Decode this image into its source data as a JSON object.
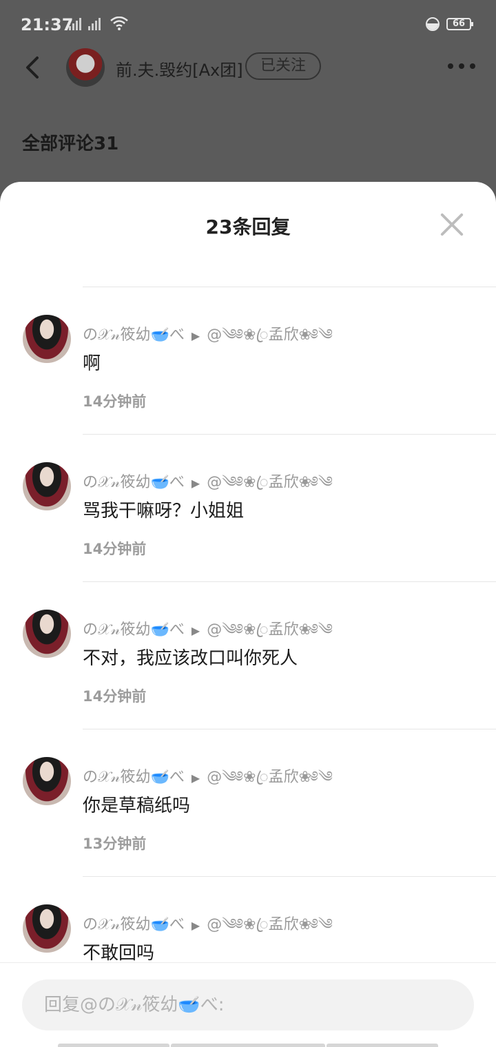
{
  "status_bar": {
    "time": "21:37",
    "battery": "66"
  },
  "header": {
    "username": "前.夫.毁约[Ax团]",
    "follow_label": "已关注"
  },
  "section": {
    "all_comments": "全部评论31"
  },
  "sheet": {
    "title": "23条回复",
    "replies": [
      {
        "author": "の𝒳𝓃筱幼🥣べ",
        "arrow": "▶",
        "target": "@༄༅❀ꦿ孟欣❀༅༄",
        "text": "啊",
        "time": "14分钟前"
      },
      {
        "author": "の𝒳𝓃筱幼🥣べ",
        "arrow": "▶",
        "target": "@༄༅❀ꦿ孟欣❀༅༄",
        "text": "骂我干嘛呀？小姐姐",
        "time": "14分钟前"
      },
      {
        "author": "の𝒳𝓃筱幼🥣べ",
        "arrow": "▶",
        "target": "@༄༅❀ꦿ孟欣❀༅༄",
        "text": "不对，我应该改口叫你死人",
        "time": "14分钟前"
      },
      {
        "author": "の𝒳𝓃筱幼🥣べ",
        "arrow": "▶",
        "target": "@༄༅❀ꦿ孟欣❀༅༄",
        "text": "你是草稿纸吗",
        "time": "13分钟前"
      },
      {
        "author": "の𝒳𝓃筱幼🥣べ",
        "arrow": "▶",
        "target": "@༄༅❀ꦿ孟欣❀༅༄",
        "text": "不敢回吗",
        "time": ""
      }
    ],
    "input_placeholder": "回复@の𝒳𝓃筱幼🥣べ:"
  }
}
